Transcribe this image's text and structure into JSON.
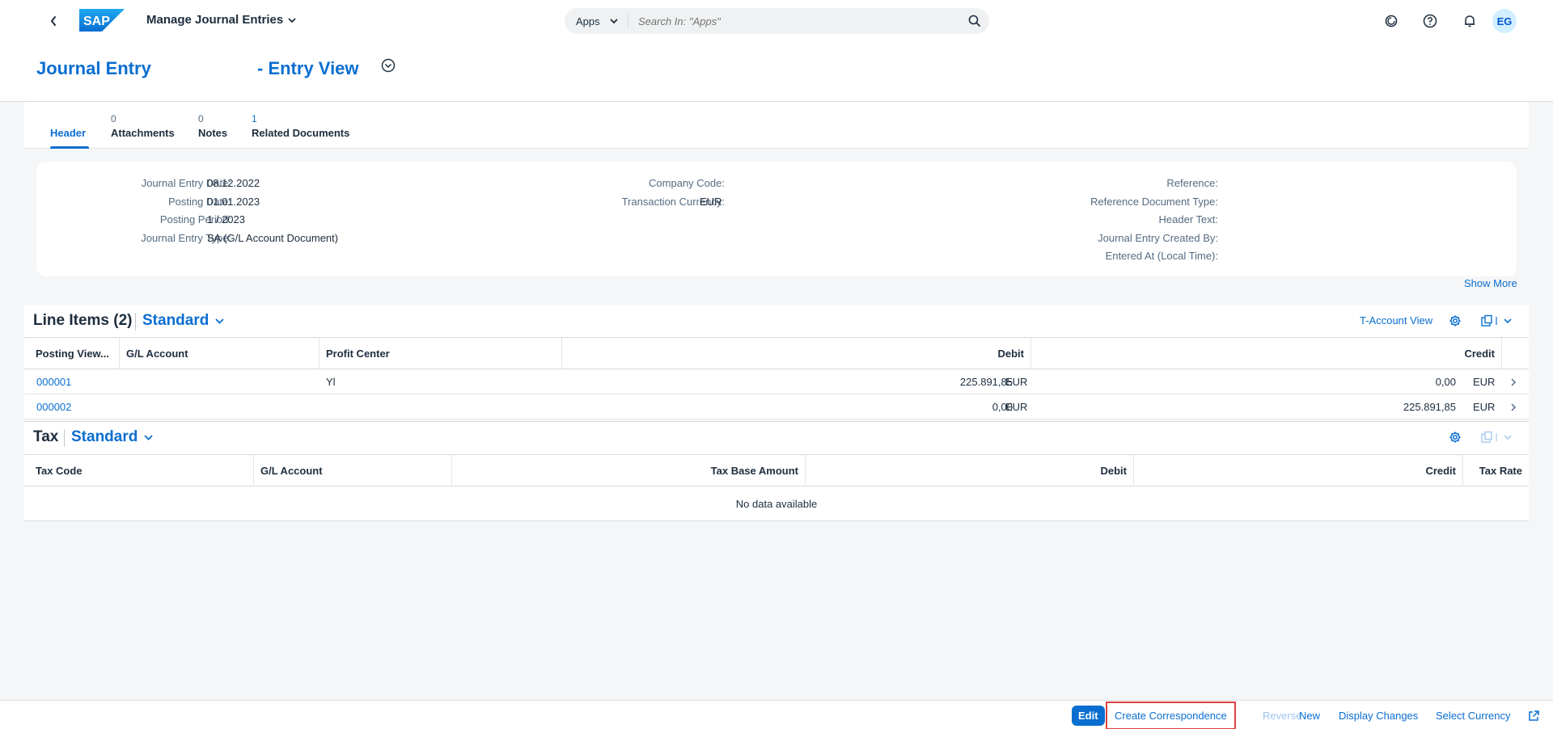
{
  "shell": {
    "app_title": "Manage Journal Entries",
    "search_scope": "Apps",
    "search_placeholder": "Search In: \"Apps\"",
    "avatar_initials": "EG"
  },
  "object_header": {
    "title": "Journal Entry",
    "title_suffix": "- Entry View"
  },
  "tabs": [
    {
      "count": "",
      "label": "Header"
    },
    {
      "count": "0",
      "label": "Attachments"
    },
    {
      "count": "0",
      "label": "Notes"
    },
    {
      "count": "1",
      "label": "Related Documents"
    }
  ],
  "header_fields": {
    "col1": [
      {
        "label": "Journal Entry Date:",
        "value": "08.12.2022"
      },
      {
        "label": "Posting Date:",
        "value": "01.01.2023"
      },
      {
        "label": "Posting Period:",
        "value": "1 / 2023"
      },
      {
        "label": "Journal Entry Type:",
        "value": "SA (G/L Account Document)"
      }
    ],
    "col2": [
      {
        "label": "Company Code:",
        "value": ""
      },
      {
        "label": "Transaction Currency:",
        "value": "EUR"
      }
    ],
    "col3": [
      {
        "label": "Reference:",
        "value": ""
      },
      {
        "label": "Reference Document Type:",
        "value": ""
      },
      {
        "label": "Header Text:",
        "value": ""
      },
      {
        "label": "Journal Entry Created By:",
        "value": ""
      },
      {
        "label": "Entered At (Local Time):",
        "value": ""
      }
    ],
    "show_more": "Show More"
  },
  "line_items": {
    "title": "Line Items (2)",
    "variant": "Standard",
    "t_account_view": "T-Account View",
    "columns": [
      "Posting View...",
      "G/L Account",
      "Profit Center",
      "Debit",
      "Credit"
    ],
    "rows": [
      {
        "posting_view": "000001",
        "gl_account": "",
        "profit_center": "Yl",
        "debit": "225.891,85",
        "debit_cur": "EUR",
        "credit": "0,00",
        "credit_cur": "EUR"
      },
      {
        "posting_view": "000002",
        "gl_account": "",
        "profit_center": "",
        "debit": "0,00",
        "debit_cur": "EUR",
        "credit": "225.891,85",
        "credit_cur": "EUR"
      }
    ]
  },
  "tax": {
    "title": "Tax",
    "variant": "Standard",
    "columns": [
      "Tax Code",
      "G/L Account",
      "Tax Base Amount",
      "Debit",
      "Credit",
      "Tax Rate"
    ],
    "no_data": "No data available"
  },
  "footer": {
    "edit": "Edit",
    "create_correspondence": "Create Correspondence",
    "reverse": "Reverse",
    "new": "New",
    "display_changes": "Display Changes",
    "select_currency": "Select Currency"
  },
  "colors": {
    "brand_blue": "#0a6ed1",
    "highlight_outline": "#e03f3f",
    "background": "#f5f6f7"
  }
}
